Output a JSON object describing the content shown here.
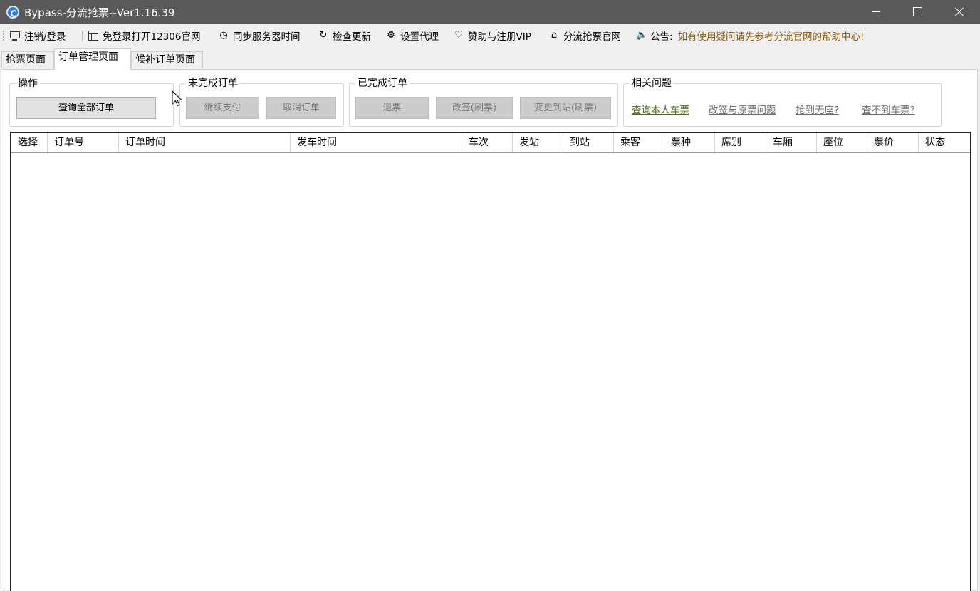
{
  "window": {
    "title": "Bypass-分流抢票--Ver1.16.39",
    "controls": {
      "minimize": "minimize",
      "maximize": "maximize",
      "close": "close"
    }
  },
  "toolbar": {
    "items": [
      {
        "label": "注销/登录",
        "icon": "monitor-icon"
      },
      {
        "label": "免登录打开12306官网",
        "icon": "window-icon"
      },
      {
        "label": "同步服务器时间",
        "icon": "clock-icon"
      },
      {
        "label": "检查更新",
        "icon": "refresh-icon"
      },
      {
        "label": "设置代理",
        "icon": "settings-icon"
      },
      {
        "label": "赞助与注册VIP",
        "icon": "heart-icon"
      },
      {
        "label": "分流抢票官网",
        "icon": "home-icon"
      },
      {
        "label": "公告:",
        "icon": "speaker-icon"
      }
    ],
    "notice": "如有使用疑问请先参考分流官网的帮助中心!"
  },
  "tabs": [
    {
      "label": "抢票页面",
      "active": false
    },
    {
      "label": "订单管理页面",
      "active": true
    },
    {
      "label": "候补订单页面",
      "active": false
    }
  ],
  "groups": {
    "operation": {
      "title": "操作",
      "query_all": "查询全部订单"
    },
    "incomplete": {
      "title": "未完成订单",
      "continue_pay": "继续支付",
      "cancel_order": "取消订单"
    },
    "completed": {
      "title": "已完成订单",
      "refund": "退票",
      "reschedule": "改签(刷票)",
      "change_station": "变更到站(刷票)"
    },
    "related": {
      "title": "相关问题",
      "links": [
        "查询本人车票",
        "改签与原票问题",
        "抢到无座?",
        "查不到车票?"
      ]
    }
  },
  "grid": {
    "columns": [
      "选择",
      "订单号",
      "订单时间",
      "发车时间",
      "车次",
      "发站",
      "到站",
      "乘客",
      "票种",
      "席别",
      "车厢",
      "座位",
      "票价",
      "状态"
    ],
    "rows": []
  },
  "colors": {
    "titlebar": "#595959",
    "notice": "#8b5a10",
    "first_link": "#4f6a1f"
  }
}
